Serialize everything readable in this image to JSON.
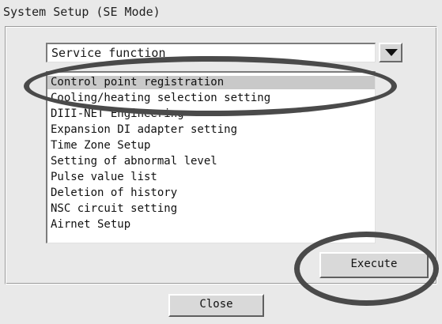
{
  "window": {
    "title": "System Setup (SE Mode)"
  },
  "select": {
    "value": "Service function"
  },
  "list": {
    "items": [
      "Control point registration",
      "Cooling/heating selection setting",
      "DIII-NET Engineering",
      "Expansion DI adapter setting",
      "Time Zone Setup",
      "Setting of abnormal level",
      "Pulse value list",
      "Deletion of history",
      "NSC circuit setting",
      "Airnet Setup"
    ],
    "selected_index": 0
  },
  "buttons": {
    "execute": "Execute",
    "close": "Close"
  },
  "icons": {
    "dropdown": "chevron-down-icon"
  },
  "colors": {
    "background": "#e9e9e9",
    "selection": "#c9c9c9",
    "annotation": "#4a4a4a"
  }
}
